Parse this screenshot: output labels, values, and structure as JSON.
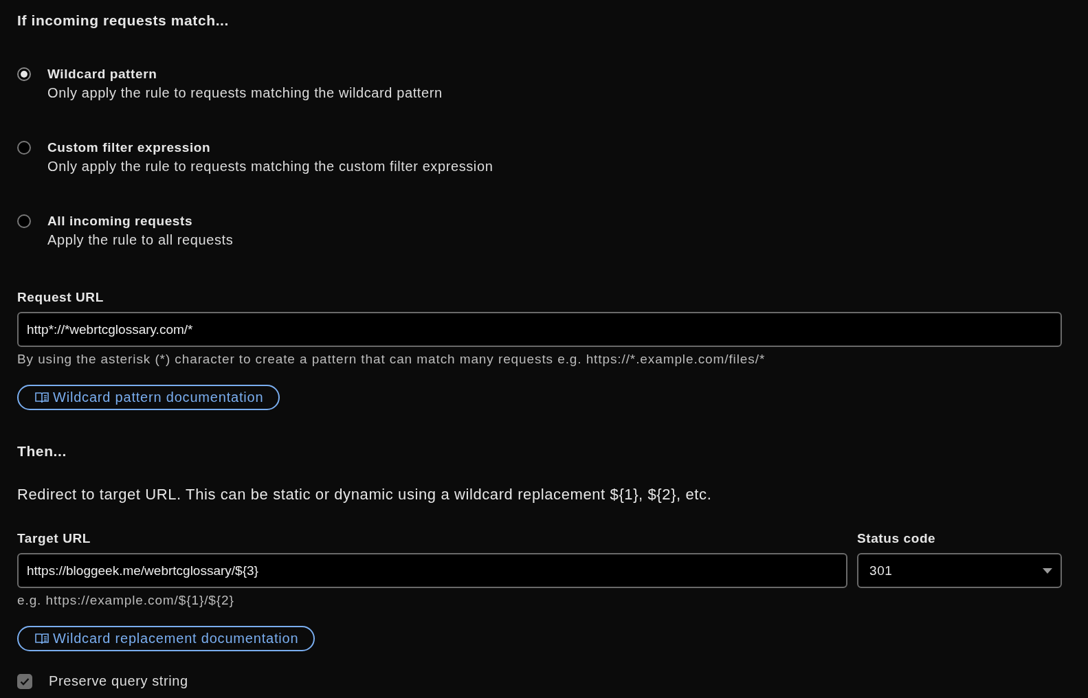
{
  "heading": "If incoming requests match...",
  "match_options": [
    {
      "title": "Wildcard pattern",
      "description": "Only apply the rule to requests matching the wildcard pattern",
      "selected": true
    },
    {
      "title": "Custom filter expression",
      "description": "Only apply the rule to requests matching the custom filter expression",
      "selected": false
    },
    {
      "title": "All incoming requests",
      "description": "Apply the rule to all requests",
      "selected": false
    }
  ],
  "request_url": {
    "label": "Request URL",
    "value": "http*://*webrtcglossary.com/*",
    "hint": "By using the asterisk (*) character to create a pattern that can match many requests e.g. https://*.example.com/files/*"
  },
  "pattern_doc_link": "Wildcard pattern documentation",
  "then_heading": "Then...",
  "redirect_text": "Redirect to target URL. This can be static or dynamic using a wildcard replacement ${1}, ${2}, etc.",
  "target_url": {
    "label": "Target URL",
    "value": "https://bloggeek.me/webrtcglossary/${3}",
    "hint": "e.g. https://example.com/${1}/${2}"
  },
  "status_code": {
    "label": "Status code",
    "value": "301"
  },
  "replacement_doc_link": "Wildcard replacement documentation",
  "preserve_query": {
    "label": "Preserve query string",
    "checked": true
  }
}
